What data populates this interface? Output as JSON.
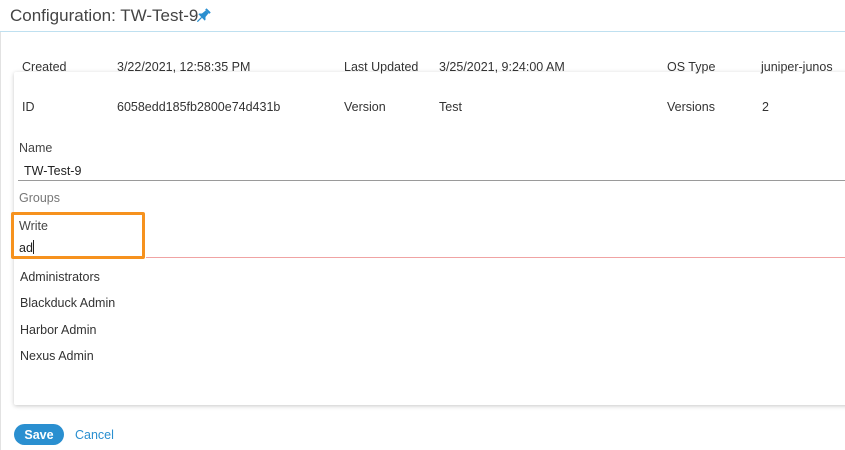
{
  "header": {
    "title": "Configuration: TW-Test-9",
    "pin_icon": "pin-icon",
    "accent_color": "#2a8fd0"
  },
  "details": {
    "created_label": "Created",
    "created_value": "3/22/2021, 12:58:35 PM",
    "updated_label": "Last Updated",
    "updated_value": "3/25/2021, 9:24:00 AM",
    "os_type_label": "OS Type",
    "os_type_value": "juniper-junos",
    "id_label": "ID",
    "id_value": "6058edd185fb2800e74d431b",
    "version_label": "Version",
    "version_value": "Test",
    "versions_label": "Versions",
    "versions_value": "2"
  },
  "form": {
    "name_label": "Name",
    "name_value": "TW-Test-9",
    "groups_label": "Groups",
    "write_label": "Write",
    "write_value": "ad",
    "highlight_color": "#f6921e",
    "options": [
      "Administrators",
      "Blackduck Admin",
      "Harbor Admin",
      "Nexus Admin"
    ]
  },
  "actions": {
    "save_label": "Save",
    "cancel_label": "Cancel"
  }
}
